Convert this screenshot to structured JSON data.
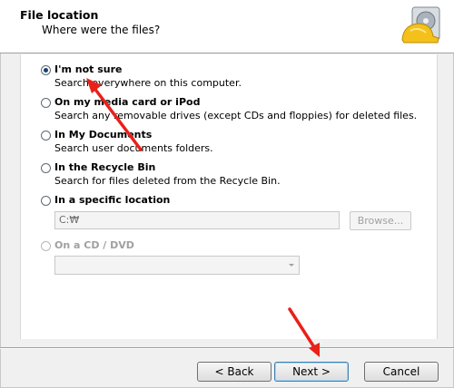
{
  "header": {
    "title": "File location",
    "subtitle": "Where were the files?",
    "icon": "hard-drive-hardhat-icon"
  },
  "options": [
    {
      "label": "I'm not sure",
      "desc": "Search everywhere on this computer.",
      "checked": true,
      "enabled": true
    },
    {
      "label": "On my media card or iPod",
      "desc": "Search any removable drives (except CDs and floppies) for deleted files.",
      "checked": false,
      "enabled": true
    },
    {
      "label": "In My Documents",
      "desc": "Search user documents folders.",
      "checked": false,
      "enabled": true
    },
    {
      "label": "In the Recycle Bin",
      "desc": "Search for files deleted from the Recycle Bin.",
      "checked": false,
      "enabled": true
    },
    {
      "label": "In a specific location",
      "desc": "",
      "checked": false,
      "enabled": true
    },
    {
      "label": "On a CD / DVD",
      "desc": "",
      "checked": false,
      "enabled": false
    }
  ],
  "location": {
    "value": "C:₩",
    "browse_label": "Browse..."
  },
  "cd_dvd": {
    "selected": ""
  },
  "buttons": {
    "back": "< Back",
    "next": "Next >",
    "cancel": "Cancel"
  },
  "colors": {
    "annotation_arrow": "#e8211a",
    "selected_radio": "#1b3f6f"
  }
}
